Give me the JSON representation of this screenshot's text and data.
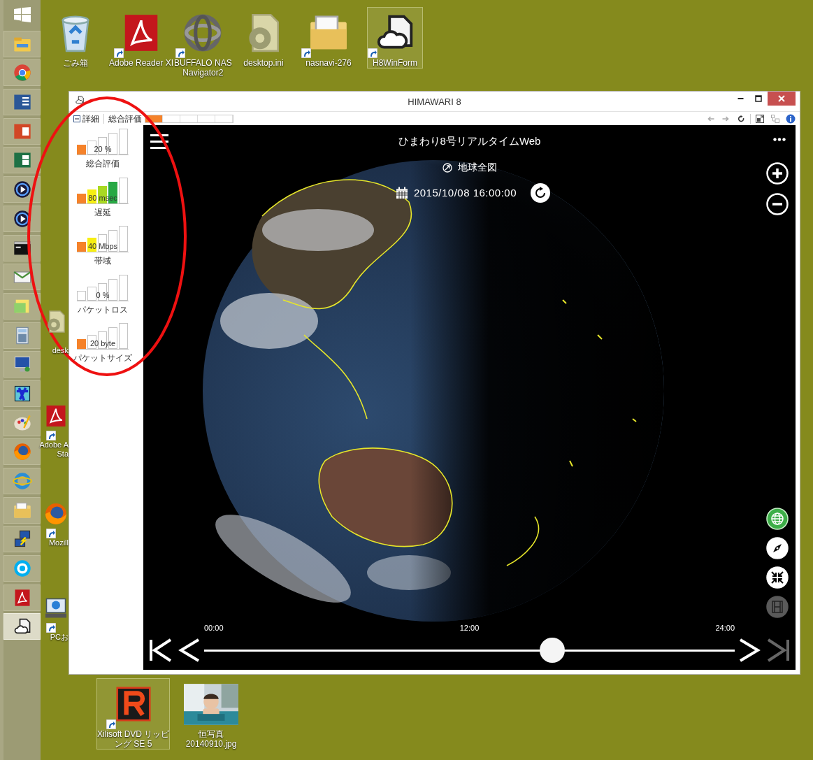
{
  "taskbar": {
    "items": [
      {
        "kind": "explorer",
        "selected": false
      },
      {
        "kind": "chrome",
        "selected": false
      },
      {
        "kind": "word",
        "selected": false
      },
      {
        "kind": "powerpoint",
        "selected": false
      },
      {
        "kind": "excel",
        "selected": false
      },
      {
        "kind": "player",
        "selected": false
      },
      {
        "kind": "player",
        "selected": false
      },
      {
        "kind": "console",
        "selected": false
      },
      {
        "kind": "mail",
        "selected": false
      },
      {
        "kind": "notes",
        "selected": false
      },
      {
        "kind": "calculator",
        "selected": false
      },
      {
        "kind": "monitor",
        "selected": false
      },
      {
        "kind": "editor",
        "selected": false
      },
      {
        "kind": "paint",
        "selected": false
      },
      {
        "kind": "firefox",
        "selected": false
      },
      {
        "kind": "browser",
        "selected": false
      },
      {
        "kind": "folder",
        "selected": false
      },
      {
        "kind": "network",
        "selected": false
      },
      {
        "kind": "skype",
        "selected": false
      },
      {
        "kind": "pdf",
        "selected": false
      },
      {
        "kind": "cloud",
        "selected": true
      }
    ]
  },
  "desktop_icons": [
    {
      "kind": "recycle",
      "lines": [
        "ごみ箱"
      ],
      "shortcut": false,
      "selected": false
    },
    {
      "kind": "pdf",
      "lines": [
        "Adobe Reader XI"
      ],
      "shortcut": true,
      "selected": false
    },
    {
      "kind": "rings",
      "lines": [
        "BUFFALO NAS",
        "Navigator2"
      ],
      "shortcut": true,
      "selected": false
    },
    {
      "kind": "gearfile",
      "lines": [
        "desktop.ini"
      ],
      "shortcut": false,
      "selected": false
    },
    {
      "kind": "folder",
      "lines": [
        "nasnavi-276"
      ],
      "shortcut": true,
      "selected": false
    },
    {
      "kind": "cloud",
      "lines": [
        "H8WinForm"
      ],
      "shortcut": true,
      "selected": true
    }
  ],
  "covered_icons": [
    {
      "kind": "gearfile",
      "lines": [
        "desk"
      ],
      "shortcut": false
    },
    {
      "kind": "pdf",
      "lines": [
        "Adobe A",
        "Sta"
      ],
      "shortcut": true
    },
    {
      "kind": "firefox",
      "lines": [
        "Mozill"
      ],
      "shortcut": true
    },
    {
      "kind": "computer",
      "lines": [
        "PCお"
      ],
      "shortcut": true
    }
  ],
  "bottom_icons": [
    {
      "kind": "ricon",
      "lines": [
        "Xilisoft DVD リッピ",
        "ング SE 5"
      ],
      "shortcut": true,
      "selected": true
    },
    {
      "lines": [
        "恒写真",
        "20140910.jpg"
      ],
      "shortcut": false,
      "selected": false
    }
  ],
  "window": {
    "title": "HIMAWARI 8",
    "toolbar": {
      "details_label": "詳細",
      "expanded": true,
      "summary_label": "総合評価",
      "summary_meter": {
        "level": 0.2
      }
    },
    "metrics": [
      {
        "value": "20 %",
        "label": "総合評価",
        "bars": [
          {
            "lit": true
          },
          {
            "lit": false
          },
          {
            "lit": false
          },
          {
            "lit": false
          },
          {
            "lit": false
          }
        ]
      },
      {
        "value": "80 msec",
        "label": "遅延",
        "bars": [
          {
            "lit": true
          },
          {
            "lit": true
          },
          {
            "lit": true
          },
          {
            "lit": true
          },
          {
            "lit": false
          }
        ]
      },
      {
        "value": "40 Mbps",
        "label": "帯域",
        "bars": [
          {
            "lit": true
          },
          {
            "lit": true
          },
          {
            "lit": false
          },
          {
            "lit": false
          },
          {
            "lit": false
          }
        ]
      },
      {
        "value": "0 %",
        "label": "パケットロス",
        "bars": [
          {
            "lit": false
          },
          {
            "lit": false
          },
          {
            "lit": false
          },
          {
            "lit": false
          },
          {
            "lit": false
          }
        ]
      },
      {
        "value": "20 byte",
        "label": "パケットサイズ",
        "bars": [
          {
            "lit": true
          },
          {
            "lit": false
          },
          {
            "lit": false
          },
          {
            "lit": false
          },
          {
            "lit": false
          }
        ]
      }
    ],
    "app": {
      "title": "ひまわり8号リアルタイムWeb",
      "region": "地球全図",
      "datetime": "2015/10/08 16:00:00",
      "map_buttons": [
        {
          "kind": "globe",
          "active": true,
          "disabled": false
        },
        {
          "kind": "compass",
          "active": false,
          "disabled": false
        },
        {
          "kind": "compress",
          "active": false,
          "disabled": false
        },
        {
          "kind": "film",
          "active": false,
          "disabled": true
        }
      ],
      "timeline": {
        "ticks": [
          "00:00",
          "12:00",
          "24:00"
        ],
        "level": 0.656,
        "last_disabled": true
      }
    }
  }
}
